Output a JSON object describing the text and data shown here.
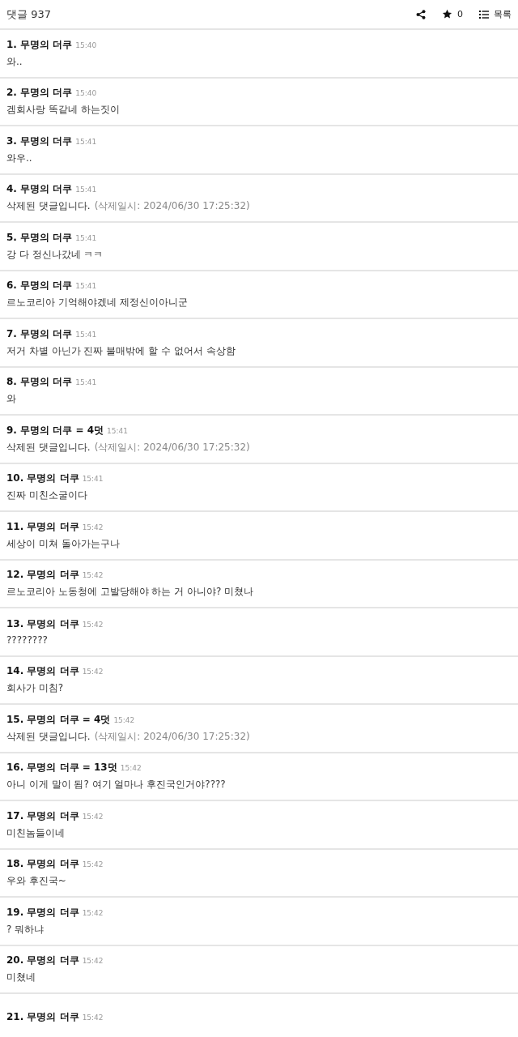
{
  "header": {
    "title": "댓글 937",
    "star_count": "0",
    "list_label": "목록"
  },
  "comments": [
    {
      "number": "1.",
      "author": "무명의 더쿠",
      "time": "15:40",
      "body": "와.."
    },
    {
      "number": "2.",
      "author": "무명의 더쿠",
      "time": "15:40",
      "body": "겜회사랑 똑같네 하는짓이"
    },
    {
      "number": "3.",
      "author": "무명의 더쿠",
      "time": "15:41",
      "body": "와우.."
    },
    {
      "number": "4.",
      "author": "무명의 더쿠",
      "time": "15:41",
      "body": "삭제된 댓글입니다.",
      "note": "(삭제일시: 2024/06/30 17:25:32)"
    },
    {
      "number": "5.",
      "author": "무명의 더쿠",
      "time": "15:41",
      "body": "강 다 정신나갔네 ㅋㅋ"
    },
    {
      "number": "6.",
      "author": "무명의 더쿠",
      "time": "15:41",
      "body": "르노코리아 기억해야겠네 제정신이아니군"
    },
    {
      "number": "7.",
      "author": "무명의 더쿠",
      "time": "15:41",
      "body": "저거 차별 아닌가 진짜 불매밖에 할 수 없어서 속상함"
    },
    {
      "number": "8.",
      "author": "무명의 더쿠",
      "time": "15:41",
      "body": "와"
    },
    {
      "number": "9.",
      "author": "무명의 더쿠",
      "reply": "= 4덧",
      "time": "15:41",
      "body": "삭제된 댓글입니다.",
      "note": "(삭제일시: 2024/06/30 17:25:32)"
    },
    {
      "number": "10.",
      "author": "무명의 더쿠",
      "time": "15:41",
      "body": "진짜 미친소굴이다"
    },
    {
      "number": "11.",
      "author": "무명의 더쿠",
      "time": "15:42",
      "body": "세상이 미쳐 돌아가는구나"
    },
    {
      "number": "12.",
      "author": "무명의 더쿠",
      "time": "15:42",
      "body": "르노코리아 노동청에 고발당해야 하는 거 아니야?  미쳤나"
    },
    {
      "number": "13.",
      "author": "무명의 더쿠",
      "time": "15:42",
      "body": "????????"
    },
    {
      "number": "14.",
      "author": "무명의 더쿠",
      "time": "15:42",
      "body": "회사가 미침?"
    },
    {
      "number": "15.",
      "author": "무명의 더쿠",
      "reply": "= 4덧",
      "time": "15:42",
      "body": "삭제된 댓글입니다.",
      "note": "(삭제일시: 2024/06/30 17:25:32)"
    },
    {
      "number": "16.",
      "author": "무명의 더쿠",
      "reply": "= 13덧",
      "time": "15:42",
      "body": "아니 이게 말이 됨?  여기 얼마나 후진국인거야????"
    },
    {
      "number": "17.",
      "author": "무명의 더쿠",
      "time": "15:42",
      "body": "미친놈들이네"
    },
    {
      "number": "18.",
      "author": "무명의 더쿠",
      "time": "15:42",
      "body": "우와 후진국~"
    },
    {
      "number": "19.",
      "author": "무명의 더쿠",
      "time": "15:42",
      "body": "?  뭐하냐"
    },
    {
      "number": "20.",
      "author": "무명의 더쿠",
      "time": "15:42",
      "body": "미쳤네"
    },
    {
      "number": "21.",
      "author": "무명의 더쿠",
      "time": "15:42"
    }
  ]
}
